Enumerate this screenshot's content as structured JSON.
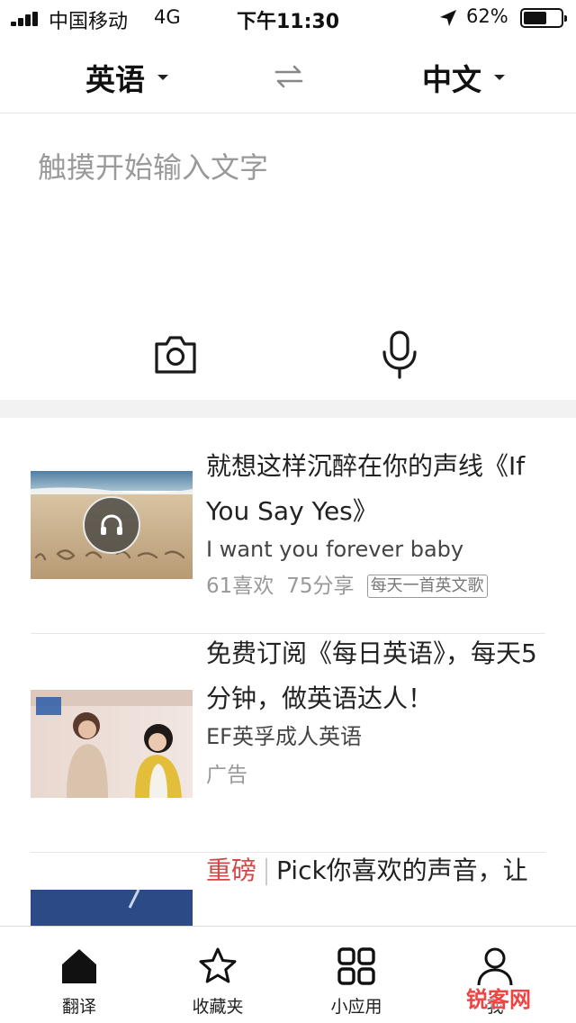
{
  "status_bar": {
    "carrier": "中国移动",
    "network": "4G",
    "time": "下午11:30",
    "battery_percent": "62%",
    "battery_level": 0.62
  },
  "language_bar": {
    "source_lang": "英语",
    "target_lang": "中文",
    "swap_icon": "swap-arrows-icon"
  },
  "input": {
    "placeholder": "触摸开始输入文字",
    "camera_icon": "camera-icon",
    "mic_icon": "microphone-icon"
  },
  "feed": {
    "items": [
      {
        "title": "就想这样沉醉在你的声线《If You Say Yes》",
        "subtitle": "I want you forever baby",
        "likes": "61喜欢",
        "shares": "75分享",
        "tag": "每天一首英文歌",
        "thumb_icon": "headphones-icon"
      },
      {
        "title": "免费订阅《每日英语》，每天5分钟，做英语达人！",
        "subtitle": "EF英孚成人英语",
        "meta": "广告"
      },
      {
        "badge": "重磅",
        "title": "Pick你喜欢的声音，让"
      }
    ]
  },
  "tab_bar": {
    "tabs": [
      {
        "label": "翻译",
        "icon": "home-icon",
        "active": true
      },
      {
        "label": "收藏夹",
        "icon": "star-icon",
        "active": false
      },
      {
        "label": "小应用",
        "icon": "apps-grid-icon",
        "active": false
      },
      {
        "label": "我",
        "icon": "person-icon",
        "active": false
      }
    ]
  },
  "watermark": "锐客网"
}
